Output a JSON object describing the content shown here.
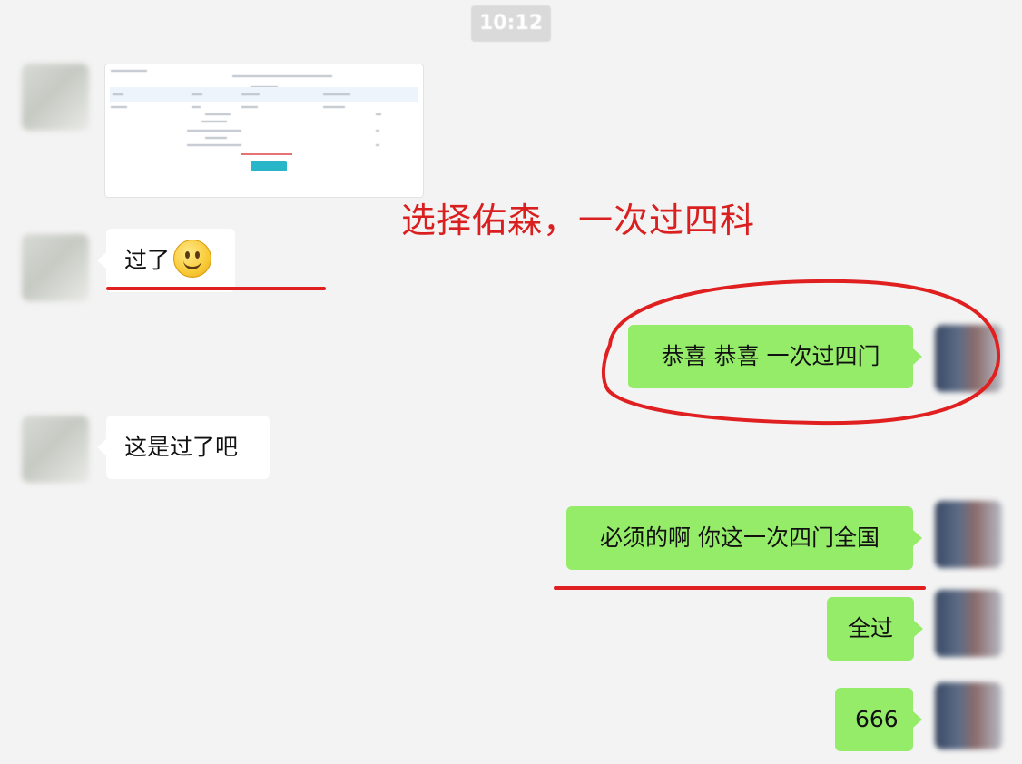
{
  "header": {
    "time": "10:12"
  },
  "annotation": {
    "caption": "选择佑森，一次过四科"
  },
  "messages": {
    "m2": "过了",
    "m3": "恭喜 恭喜 一次过四门",
    "m4": "这是过了吧",
    "m5": "必须的啊 你这一次四门全国",
    "m6": "全过",
    "m7": "666"
  },
  "colors": {
    "outgoing_bubble": "#95ec69",
    "incoming_bubble": "#ffffff",
    "annotation_red": "#d91f1f",
    "background": "#f3f3f3"
  },
  "icons": {
    "emoji": "smiley-face-icon"
  }
}
